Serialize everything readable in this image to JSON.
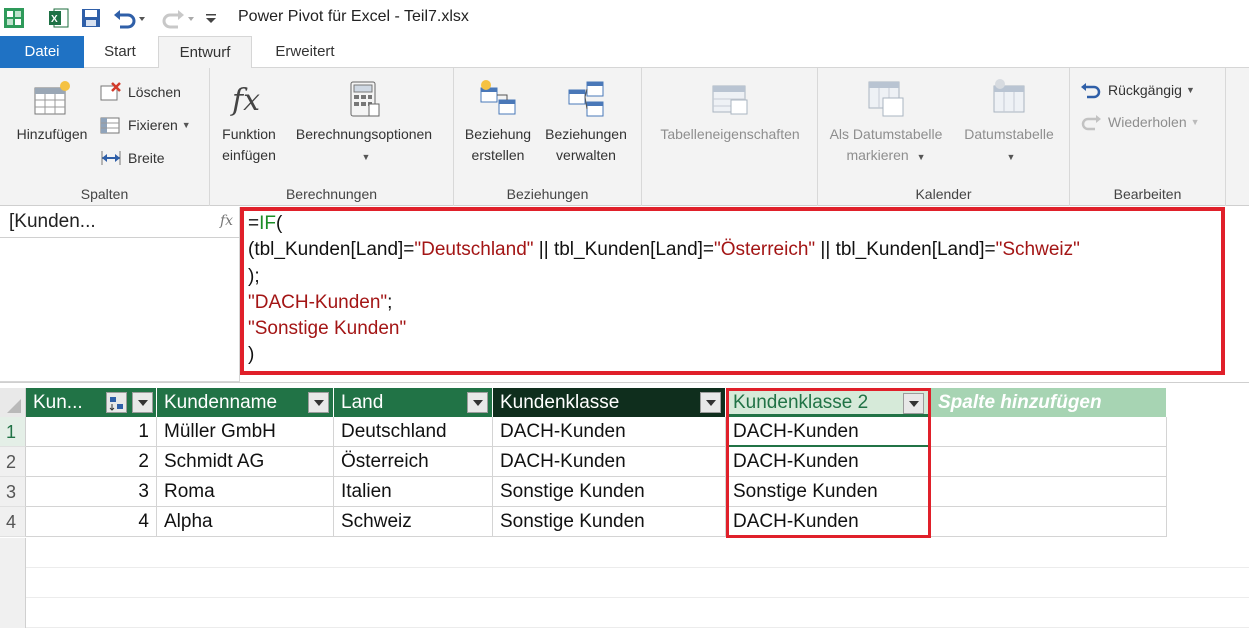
{
  "window": {
    "title": "Power Pivot für Excel - Teil7.xlsx"
  },
  "tabs": [
    {
      "label": "Datei"
    },
    {
      "label": "Start"
    },
    {
      "label": "Entwurf"
    },
    {
      "label": "Erweitert"
    }
  ],
  "ribbon": {
    "spalten": {
      "label": "Spalten",
      "add": "Hinzufügen",
      "delete": "Löschen",
      "freeze": "Fixieren",
      "width": "Breite"
    },
    "berechnungen": {
      "label": "Berechnungen",
      "insert_fn_line1": "Funktion",
      "insert_fn_line2": "einfügen",
      "calc_options": "Berechnungsoptionen"
    },
    "beziehungen": {
      "label": "Beziehungen",
      "create_line1": "Beziehung",
      "create_line2": "erstellen",
      "manage_line1": "Beziehungen",
      "manage_line2": "verwalten"
    },
    "table_props": "Tabelleneigenschaften",
    "kalender": {
      "label": "Kalender",
      "mark_line1": "Als Datumstabelle",
      "mark_line2": "markieren",
      "date_table": "Datumstabelle"
    },
    "bearbeiten": {
      "label": "Bearbeiten",
      "undo": "Rückgängig",
      "redo": "Wiederholen"
    }
  },
  "formula_bar": {
    "name_box": "[Kunden...",
    "fx": "fx",
    "formula": {
      "l1_eq": "=",
      "l1_fn": "IF",
      "l1_paren": "(",
      "l2_a": "(tbl_Kunden[Land]=",
      "l2_s1": "\"Deutschland\"",
      "l2_b": " || tbl_Kunden[Land]=",
      "l2_s2": "\"Österreich\"",
      "l2_c": " || tbl_Kunden[Land]=",
      "l2_s3": "\"Schweiz\"",
      "l3": ");",
      "l4_s": "\"DACH-Kunden\"",
      "l4_semi": ";",
      "l5_s": "\"Sonstige Kunden\"",
      "l6": ")"
    }
  },
  "table": {
    "columns": [
      "Kun...",
      "Kundenname",
      "Land",
      "Kundenklasse",
      "Kundenklasse 2",
      "Spalte hinzufügen"
    ],
    "rows": [
      {
        "num": "1",
        "id": "1",
        "name": "Müller GmbH",
        "land": "Deutschland",
        "klasse": "DACH-Kunden",
        "klasse2": "DACH-Kunden"
      },
      {
        "num": "2",
        "id": "2",
        "name": "Schmidt AG",
        "land": "Österreich",
        "klasse": "DACH-Kunden",
        "klasse2": "DACH-Kunden"
      },
      {
        "num": "3",
        "id": "3",
        "name": "Roma",
        "land": "Italien",
        "klasse": "Sonstige Kunden",
        "klasse2": "Sonstige Kunden"
      },
      {
        "num": "4",
        "id": "4",
        "name": "Alpha",
        "land": "Schweiz",
        "klasse": "Sonstige Kunden",
        "klasse2": "DACH-Kunden"
      }
    ]
  },
  "colors": {
    "accent_green": "#217346",
    "highlight_red": "#e0202a",
    "file_tab_blue": "#1f72c4",
    "dax_function": "#1a8c25",
    "dax_string": "#a31515"
  }
}
